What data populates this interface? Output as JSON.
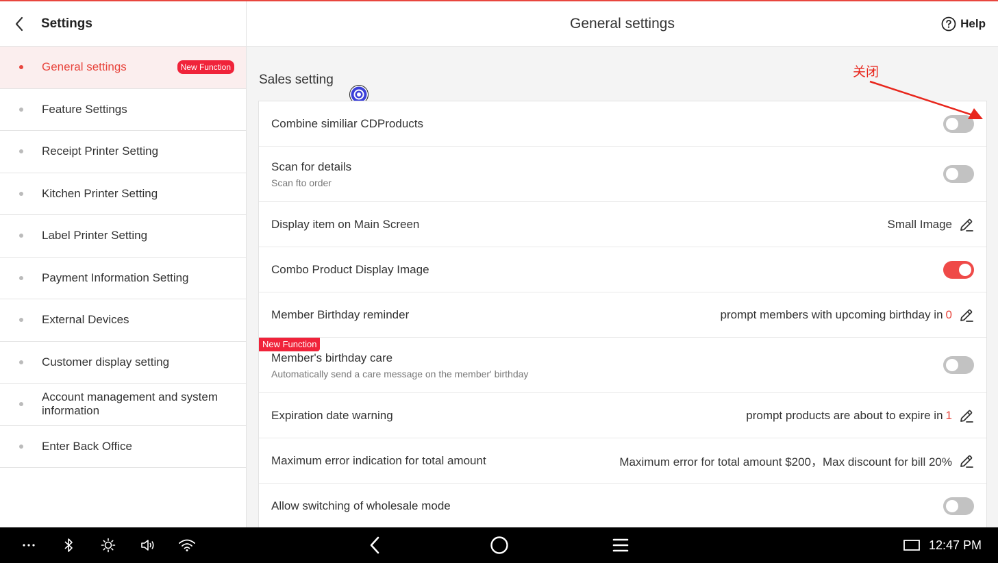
{
  "left": {
    "title": "Settings",
    "items": [
      {
        "label": "General settings",
        "badge": "New Function",
        "active": true
      },
      {
        "label": "Feature Settings"
      },
      {
        "label": "Receipt Printer Setting"
      },
      {
        "label": "Kitchen Printer Setting"
      },
      {
        "label": "Label Printer Setting"
      },
      {
        "label": "Payment Information Setting"
      },
      {
        "label": "External Devices"
      },
      {
        "label": "Customer display setting"
      },
      {
        "label": "Account management and system information"
      },
      {
        "label": "Enter Back Office"
      }
    ]
  },
  "header": {
    "title": "General settings",
    "help_label": "Help"
  },
  "section": {
    "title": "Sales setting"
  },
  "annotation": {
    "text": "关闭",
    "color": "#e8261c"
  },
  "rows": {
    "combine": {
      "label": "Combine similiar CDProducts",
      "toggle": "off"
    },
    "scan": {
      "label": "Scan for details",
      "sub": "Scan fto order",
      "toggle": "off"
    },
    "display": {
      "label": "Display item on Main Screen",
      "value": "Small Image"
    },
    "combo": {
      "label": "Combo Product Display Image",
      "toggle": "on"
    },
    "birthday_reminder": {
      "label": "Member Birthday reminder",
      "value": "prompt members with upcoming birthday in",
      "number": "0"
    },
    "birthday_care": {
      "label": "Member's birthday care",
      "sub": "Automatically send a care message on the member' birthday",
      "badge": "New Function",
      "toggle": "off"
    },
    "expiration": {
      "label": "Expiration date warning",
      "value": "prompt products are about to expire in",
      "number": "1"
    },
    "max_error": {
      "label": "Maximum error indication for total amount",
      "value": "Maximum error for total amount $200，Max discount for bill 20%"
    },
    "wholesale": {
      "label": "Allow switching of wholesale mode",
      "toggle": "off"
    }
  },
  "statusbar": {
    "time": "12:47 PM"
  },
  "colors": {
    "accent": "#e8463e",
    "toggle_on": "#ef4a48",
    "toggle_off": "#c2c2c2",
    "badge": "#f0233a"
  }
}
